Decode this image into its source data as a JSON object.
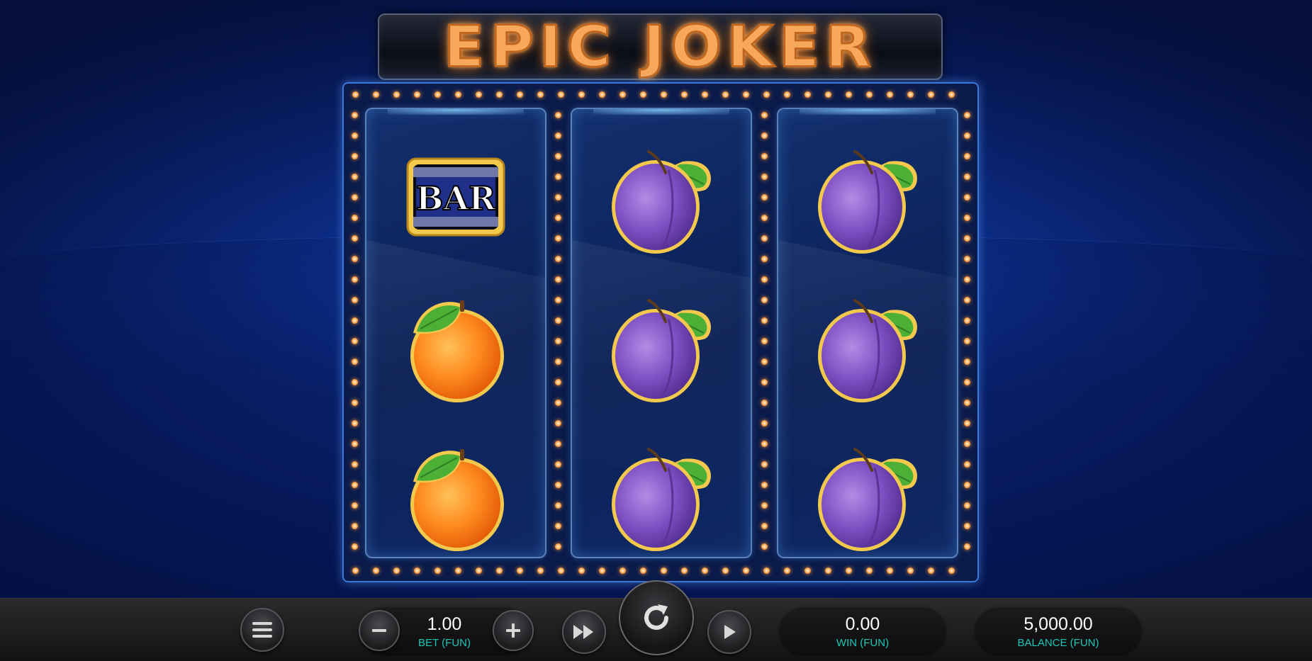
{
  "game": {
    "title": "EPIC JOKER"
  },
  "reels": [
    {
      "symbols": [
        "bar",
        "orange",
        "orange"
      ]
    },
    {
      "symbols": [
        "plum",
        "plum",
        "plum"
      ]
    },
    {
      "symbols": [
        "plum",
        "plum",
        "plum"
      ]
    }
  ],
  "symbol_text": {
    "bar": "BAR"
  },
  "controls": {
    "menu_icon": "hamburger-menu-icon",
    "bet": {
      "value": "1.00",
      "label": "BET (FUN)"
    },
    "decrease_icon": "minus-icon",
    "increase_icon": "plus-icon",
    "turbo_icon": "fast-forward-icon",
    "spin_icon": "rotate-arrow-icon",
    "autoplay_icon": "play-icon",
    "win": {
      "value": "0.00",
      "label": "WIN (FUN)"
    },
    "balance": {
      "value": "5,000.00",
      "label": "BALANCE (FUN)"
    }
  },
  "colors": {
    "label_accent": "#19c7b7",
    "bulb": "#ffb460",
    "frame": "#3d78d8"
  }
}
